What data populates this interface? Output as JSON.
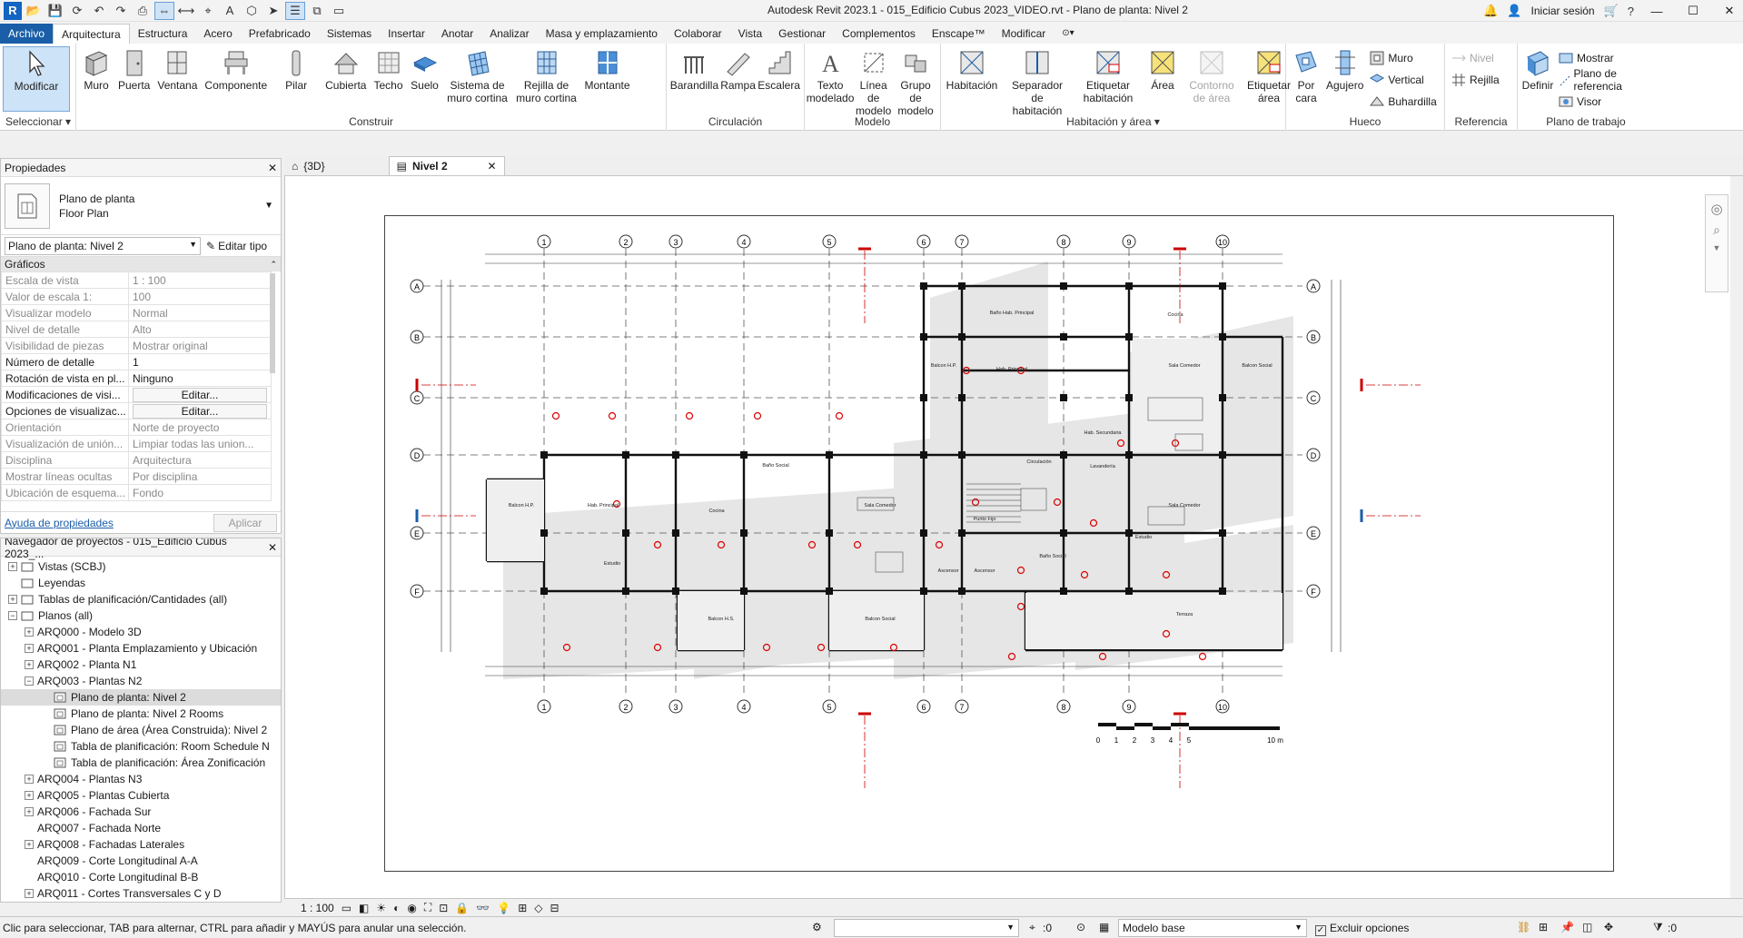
{
  "app": {
    "logo": "R",
    "title": "Autodesk Revit 2023.1 - 015_Edificio Cubus 2023_VIDEO.rvt - Plano de planta: Nivel 2",
    "sign_in": "Iniciar sesión"
  },
  "menu": {
    "tabs": [
      "Archivo",
      "Arquitectura",
      "Estructura",
      "Acero",
      "Prefabricado",
      "Sistemas",
      "Insertar",
      "Anotar",
      "Analizar",
      "Masa y emplazamiento",
      "Colaborar",
      "Vista",
      "Gestionar",
      "Complementos",
      "Enscape™",
      "Modificar"
    ],
    "active": "Arquitectura"
  },
  "ribbon": {
    "select": {
      "tool": "Modificar",
      "label": "Seleccionar ▾"
    },
    "build": {
      "label": "Construir",
      "tools": [
        "Muro",
        "Puerta",
        "Ventana",
        "Componente",
        "Pilar",
        "Cubierta",
        "Techo",
        "Suelo",
        "Sistema de\nmuro cortina",
        "Rejilla de\nmuro cortina",
        "Montante"
      ]
    },
    "circulation": {
      "label": "Circulación",
      "tools": [
        "Barandilla",
        "Rampa",
        "Escalera"
      ]
    },
    "model": {
      "label": "Modelo",
      "tools": [
        "Texto\nmodelado",
        "Línea de\nmodelo",
        "Grupo de\nmodelo"
      ]
    },
    "room": {
      "label": "Habitación y área ▾",
      "tools": [
        "Habitación",
        "Separador\nde habitación",
        "Etiquetar\nhabitación",
        "Área",
        "Contorno\nde área",
        "Etiquetar\nárea"
      ]
    },
    "opening": {
      "label": "Hueco",
      "tools": [
        "Por\ncara",
        "Agujero"
      ],
      "small": [
        "Muro",
        "Vertical",
        "Buhardilla"
      ]
    },
    "datum": {
      "label": "Referencia",
      "small": [
        "Nivel",
        "Rejilla"
      ]
    },
    "workplane": {
      "label": "Plano de trabajo",
      "tool": "Definir",
      "small": [
        "Mostrar",
        "Plano de referencia",
        "Visor"
      ]
    }
  },
  "properties": {
    "title": "Propiedades",
    "type_line1": "Plano de planta",
    "type_line2": "Floor Plan",
    "instance": "Plano de planta: Nivel 2",
    "edit_type": "Editar tipo",
    "group": "Gráficos",
    "rows": [
      {
        "k": "Escala de vista",
        "v": "1 : 100",
        "on": false
      },
      {
        "k": "Valor de escala    1:",
        "v": "100",
        "on": false
      },
      {
        "k": "Visualizar modelo",
        "v": "Normal",
        "on": false
      },
      {
        "k": "Nivel de detalle",
        "v": "Alto",
        "on": false
      },
      {
        "k": "Visibilidad de piezas",
        "v": "Mostrar original",
        "on": false
      },
      {
        "k": "Número de detalle",
        "v": "1",
        "on": true
      },
      {
        "k": "Rotación de vista en pl...",
        "v": "Ninguno",
        "on": true
      },
      {
        "k": "Modificaciones de visi...",
        "v": "Editar...",
        "on": true,
        "btn": true
      },
      {
        "k": "Opciones de visualizac...",
        "v": "Editar...",
        "on": true,
        "btn": true
      },
      {
        "k": "Orientación",
        "v": "Norte de proyecto",
        "on": false
      },
      {
        "k": "Visualización de unión...",
        "v": "Limpiar todas las union...",
        "on": false
      },
      {
        "k": "Disciplina",
        "v": "Arquitectura",
        "on": false
      },
      {
        "k": "Mostrar líneas ocultas",
        "v": "Por disciplina",
        "on": false
      },
      {
        "k": "Ubicación de esquema...",
        "v": "Fondo",
        "on": false
      }
    ],
    "help": "Ayuda de propiedades",
    "apply": "Aplicar"
  },
  "browser": {
    "title": "Navegador de proyectos - 015_Edificio Cubus 2023_...",
    "items": [
      {
        "label": "Vistas (SCBJ)",
        "level": 0,
        "exp": "+"
      },
      {
        "label": "Leyendas",
        "level": 0,
        "exp": ""
      },
      {
        "label": "Tablas de planificación/Cantidades (all)",
        "level": 0,
        "exp": "+"
      },
      {
        "label": "Planos (all)",
        "level": 0,
        "exp": "-"
      },
      {
        "label": "ARQ000 - Modelo 3D",
        "level": 1,
        "exp": "+"
      },
      {
        "label": "ARQ001 - Planta Emplazamiento y Ubicación",
        "level": 1,
        "exp": "+"
      },
      {
        "label": "ARQ002 - Planta N1",
        "level": 1,
        "exp": "+"
      },
      {
        "label": "ARQ003 - Plantas N2",
        "level": 1,
        "exp": "-"
      },
      {
        "label": "Plano de planta: Nivel 2",
        "level": 2,
        "exp": "",
        "sel": true
      },
      {
        "label": "Plano de planta: Nivel 2 Rooms",
        "level": 2,
        "exp": ""
      },
      {
        "label": "Plano de área (Área Construida): Nivel 2",
        "level": 2,
        "exp": ""
      },
      {
        "label": "Tabla de planificación: Room Schedule N",
        "level": 2,
        "exp": ""
      },
      {
        "label": "Tabla de planificación: Área Zonificación",
        "level": 2,
        "exp": ""
      },
      {
        "label": "ARQ004 - Plantas N3",
        "level": 1,
        "exp": "+"
      },
      {
        "label": "ARQ005 - Plantas Cubierta",
        "level": 1,
        "exp": "+"
      },
      {
        "label": "ARQ006 - Fachada Sur",
        "level": 1,
        "exp": "+"
      },
      {
        "label": "ARQ007 - Fachada Norte",
        "level": 1,
        "exp": ""
      },
      {
        "label": "ARQ008 - Fachadas Laterales",
        "level": 1,
        "exp": "+"
      },
      {
        "label": "ARQ009 - Corte Longitudinal A-A",
        "level": 1,
        "exp": ""
      },
      {
        "label": "ARQ010 - Corte Longitudinal B-B",
        "level": 1,
        "exp": ""
      },
      {
        "label": "ARQ011 - Cortes Transversales C y D",
        "level": 1,
        "exp": "+"
      }
    ]
  },
  "viewtabs": [
    {
      "label": "{3D}",
      "active": false
    },
    {
      "label": "Nivel 2",
      "active": true
    }
  ],
  "drawing": {
    "grid_top": [
      "1",
      "2",
      "3",
      "4",
      "5",
      "6",
      "7",
      "8",
      "9",
      "10"
    ],
    "grid_side": [
      "A",
      "B",
      "C",
      "D",
      "E",
      "F"
    ],
    "section_marks": [
      "A",
      "B",
      "C",
      "D"
    ],
    "rooms": [
      "Balcon H.P.",
      "Baño Hab. Principal",
      "Hab. Principal",
      "Cocina",
      "Sala Comedor",
      "Balcon Social",
      "Hab. Secundaria",
      "Estudio",
      "Circulación",
      "Lavandería",
      "Baño Social",
      "Punto Fijo",
      "Ascensor",
      "Terraza",
      "Balcon H.S."
    ],
    "scale_ticks": [
      "0",
      "1",
      "2",
      "3",
      "4",
      "5",
      "10 m"
    ]
  },
  "viewbar": {
    "scale": "1 : 100"
  },
  "status": {
    "text": "Clic para seleccionar, TAB para alternar, CTRL para añadir y MAYÚS para anular una selección.",
    "selection_count": ":0",
    "model": "Modelo base",
    "exclude": "Excluir opciones",
    "filter_count": ":0"
  }
}
